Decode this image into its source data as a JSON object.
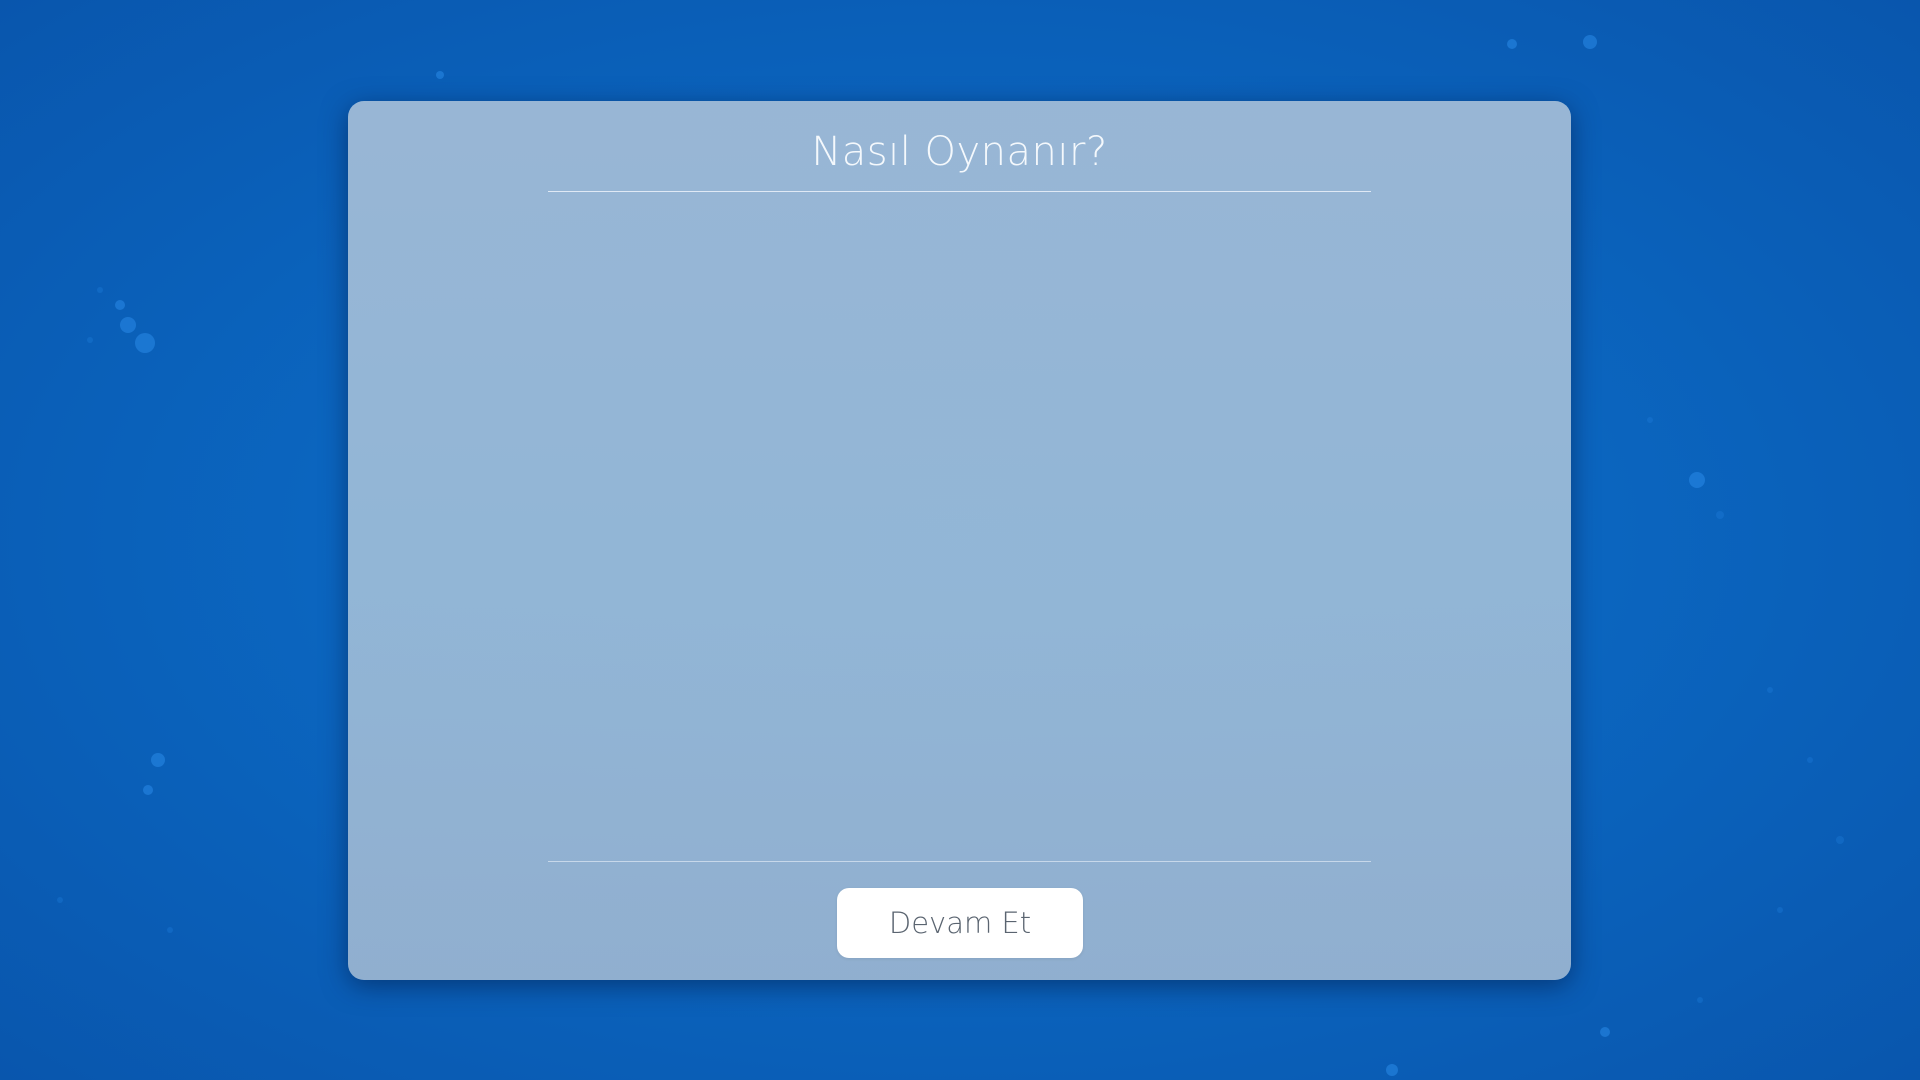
{
  "dialog": {
    "title": "Nasıl Oynanır?",
    "continue_label": "Devam Et"
  },
  "colors": {
    "background": "#0b66c0",
    "panel": "#97b9d7",
    "title_text": "#f4f8fc",
    "button_bg": "#ffffff",
    "button_text": "#5a6470"
  }
}
